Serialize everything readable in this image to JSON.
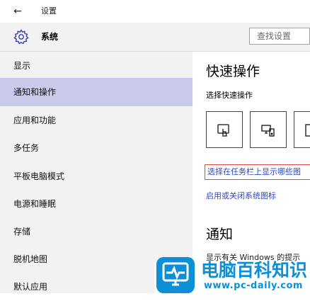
{
  "window": {
    "back_icon": "back-arrow-icon",
    "back_glyph": "←",
    "title": "设置"
  },
  "header": {
    "gear_icon": "gear-icon",
    "title": "系统",
    "search_placeholder": "查找设置"
  },
  "sidebar": {
    "items": [
      {
        "label": "显示",
        "active": false
      },
      {
        "label": "通知和操作",
        "active": true
      },
      {
        "label": "应用和功能",
        "active": false
      },
      {
        "label": "多任务",
        "active": false
      },
      {
        "label": "平板电脑模式",
        "active": false
      },
      {
        "label": "电源和睡眠",
        "active": false
      },
      {
        "label": "存储",
        "active": false
      },
      {
        "label": "脱机地图",
        "active": false
      },
      {
        "label": "默认应用",
        "active": false
      }
    ]
  },
  "main": {
    "quick_actions_title": "快速操作",
    "quick_actions_subtitle": "选择快速操作",
    "tiles": [
      {
        "icon": "touch-icon"
      },
      {
        "icon": "connect-display-icon"
      },
      {
        "icon": "tile-icon"
      }
    ],
    "taskbar_icons_link": "选择在任务栏上显示哪些图",
    "system_icons_link": "启用或关闭系统图标",
    "notifications_title": "通知",
    "notifications_desc": "显示有关 Windows 的提示"
  },
  "watermark": {
    "logo_icon": "monitor-logo-icon",
    "title": "电脑百科知识",
    "url": "www.pc-daily.com"
  },
  "colors": {
    "sidebar_bg": "#f2f2f2",
    "active_item": "#cacaeb",
    "link": "#2f47c4",
    "highlight_border": "#e04848",
    "watermark": "#0d8fd6"
  }
}
